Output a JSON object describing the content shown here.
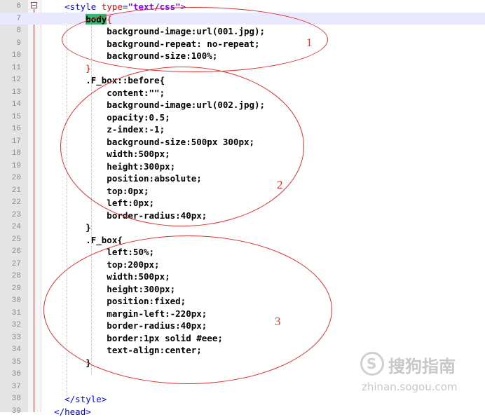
{
  "editor": {
    "lines": [
      {
        "num": "6",
        "parts": [
          {
            "t": "    "
          },
          {
            "t": "<style ",
            "c": "tag"
          },
          {
            "t": "type",
            "c": "attr"
          },
          {
            "t": "=",
            "c": "tag"
          },
          {
            "t": "\"text/css\"",
            "c": "str"
          },
          {
            "t": ">",
            "c": "tag"
          }
        ]
      },
      {
        "num": "7",
        "parts": [
          {
            "t": "        "
          },
          {
            "t": "body",
            "c": "body-hl"
          },
          {
            "t": "{",
            "c": "brace-red"
          }
        ]
      },
      {
        "num": "8",
        "parts": [
          {
            "t": "            background-image:url(001.jpg);"
          }
        ]
      },
      {
        "num": "9",
        "parts": [
          {
            "t": "            background-repeat: no-repeat;"
          }
        ]
      },
      {
        "num": "10",
        "parts": [
          {
            "t": "            background-size:100%;"
          }
        ]
      },
      {
        "num": "11",
        "parts": [
          {
            "t": "        "
          },
          {
            "t": "}",
            "c": "brace-red"
          }
        ]
      },
      {
        "num": "12",
        "parts": [
          {
            "t": "        .F_box::before{"
          }
        ]
      },
      {
        "num": "13",
        "parts": [
          {
            "t": "            content:\"\";"
          }
        ]
      },
      {
        "num": "14",
        "parts": [
          {
            "t": "            background-image:url(002.jpg);"
          }
        ]
      },
      {
        "num": "15",
        "parts": [
          {
            "t": "            opacity:0.5;"
          }
        ]
      },
      {
        "num": "16",
        "parts": [
          {
            "t": "            z-index:-1;"
          }
        ]
      },
      {
        "num": "17",
        "parts": [
          {
            "t": "            background-size:500px 300px;"
          }
        ]
      },
      {
        "num": "18",
        "parts": [
          {
            "t": "            width:500px;"
          }
        ]
      },
      {
        "num": "19",
        "parts": [
          {
            "t": "            height:300px;"
          }
        ]
      },
      {
        "num": "20",
        "parts": [
          {
            "t": "            position:absolute;"
          }
        ]
      },
      {
        "num": "21",
        "parts": [
          {
            "t": "            top:0px;"
          }
        ]
      },
      {
        "num": "22",
        "parts": [
          {
            "t": "            left:0px;"
          }
        ]
      },
      {
        "num": "23",
        "parts": [
          {
            "t": "            border-radius:40px;"
          }
        ]
      },
      {
        "num": "24",
        "parts": [
          {
            "t": "        }"
          }
        ]
      },
      {
        "num": "25",
        "parts": [
          {
            "t": "        .F_box{"
          }
        ]
      },
      {
        "num": "26",
        "parts": [
          {
            "t": "            left:50%;"
          }
        ]
      },
      {
        "num": "27",
        "parts": [
          {
            "t": "            top:200px;"
          }
        ]
      },
      {
        "num": "28",
        "parts": [
          {
            "t": "            width:500px;"
          }
        ]
      },
      {
        "num": "29",
        "parts": [
          {
            "t": "            height:300px;"
          }
        ]
      },
      {
        "num": "30",
        "parts": [
          {
            "t": "            position:fixed;"
          }
        ]
      },
      {
        "num": "31",
        "parts": [
          {
            "t": "            margin-left:-220px;"
          }
        ]
      },
      {
        "num": "32",
        "parts": [
          {
            "t": "            border-radius:40px;"
          }
        ]
      },
      {
        "num": "33",
        "parts": [
          {
            "t": "            border:1px solid #eee;"
          }
        ]
      },
      {
        "num": "34",
        "parts": [
          {
            "t": "            text-align:center;"
          }
        ]
      },
      {
        "num": "35",
        "parts": [
          {
            "t": "        }"
          }
        ]
      },
      {
        "num": "36",
        "parts": []
      },
      {
        "num": "37",
        "parts": []
      },
      {
        "num": "38",
        "parts": [
          {
            "t": "    "
          },
          {
            "t": "</style>",
            "c": "tag"
          }
        ]
      },
      {
        "num": "39",
        "parts": [
          {
            "t": "  "
          },
          {
            "t": "</head>",
            "c": "tag"
          }
        ]
      }
    ],
    "highlighted_line": "7"
  },
  "annotations": {
    "one": "1",
    "two": "2",
    "three": "3"
  },
  "watermark": {
    "brand": "搜狗指南",
    "url": "zhinan.sogou.com"
  },
  "colors": {
    "annotation": "#e03030",
    "tag": "#0000ff",
    "attr": "#ff0000",
    "string": "#8000ff"
  }
}
